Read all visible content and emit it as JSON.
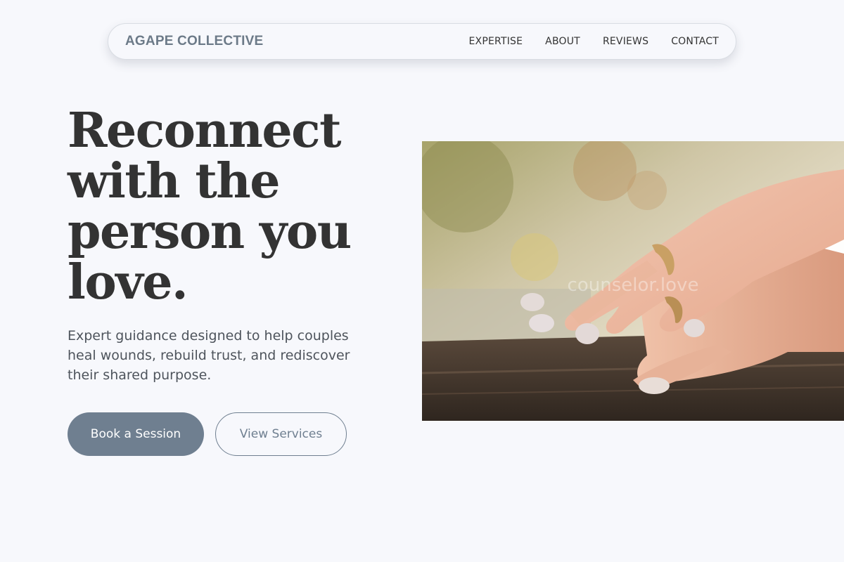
{
  "header": {
    "brand": "AGAPE COLLECTIVE",
    "nav": [
      {
        "label": "EXPERTISE"
      },
      {
        "label": "ABOUT"
      },
      {
        "label": "REVIEWS"
      },
      {
        "label": "CONTACT"
      }
    ]
  },
  "hero": {
    "headline": "Reconnect with the person you love.",
    "subtitle": "Expert guidance designed to help couples heal wounds, rebuild trust, and rediscover their shared purpose.",
    "primary_cta": "Book a Session",
    "secondary_cta": "View Services",
    "image": {
      "icon": "photo-couple-hands-rings",
      "watermark": "counselor.love"
    }
  },
  "colors": {
    "background": "#f7f8fc",
    "brand": "#6c7a88",
    "accent": "#6f7f90",
    "text": "#333333"
  }
}
